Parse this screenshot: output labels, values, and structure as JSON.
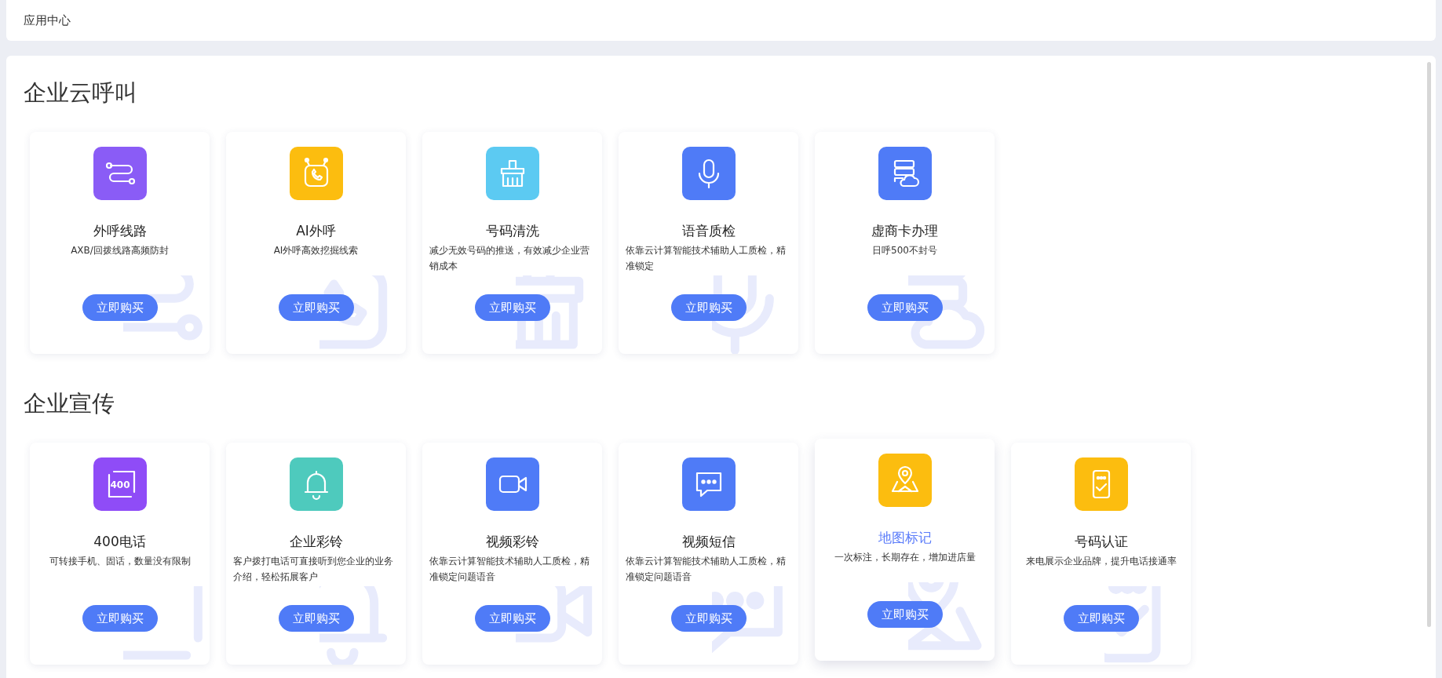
{
  "header": {
    "title": "应用中心"
  },
  "sections": [
    {
      "title": "企业云呼叫",
      "cards": [
        {
          "kind": "route",
          "color": "#8a5cf6",
          "title": "外呼线路",
          "description": "AXB/回拨线路高频防封",
          "button": "立即购买",
          "hovered": false
        },
        {
          "kind": "robot",
          "color": "#fcbd0f",
          "title": "AI外呼",
          "description": "AI外呼高效挖掘线索",
          "button": "立即购买",
          "hovered": false
        },
        {
          "kind": "brush",
          "color": "#5ccaf2",
          "title": "号码清洗",
          "description": "减少无效号码的推送，有效减少企业营销成本",
          "button": "立即购买",
          "hovered": false
        },
        {
          "kind": "mic",
          "color": "#4f7bf7",
          "title": "语音质检",
          "description": "依靠云计算智能技术辅助人工质检，精准锁定",
          "button": "立即购买",
          "hovered": false
        },
        {
          "kind": "server",
          "color": "#4f7bf7",
          "title": "虚商卡办理",
          "description": "日呼500不封号",
          "button": "立即购买",
          "hovered": false
        }
      ]
    },
    {
      "title": "企业宣传",
      "cards": [
        {
          "kind": "number",
          "icon_label": "400",
          "color": "#8f4cf7",
          "title": "400电话",
          "description": "可转接手机、固话，数量没有限制",
          "button": "立即购买",
          "hovered": false
        },
        {
          "kind": "bell",
          "color": "#4ecabd",
          "title": "企业彩铃",
          "description": "客户拨打电话可直接听到您企业的业务介绍，轻松拓展客户",
          "button": "立即购买",
          "hovered": false
        },
        {
          "kind": "video",
          "color": "#4f7bf7",
          "title": "视频彩铃",
          "description": "依靠云计算智能技术辅助人工质检，精准锁定问题语音",
          "button": "立即购买",
          "hovered": false
        },
        {
          "kind": "chat",
          "color": "#4f7bf7",
          "title": "视频短信",
          "description": "依靠云计算智能技术辅助人工质检，精准锁定问题语音",
          "button": "立即购买",
          "hovered": false
        },
        {
          "kind": "map",
          "color": "#fcbd0f",
          "title": "地图标记",
          "description": "一次标注，长期存在，增加进店量",
          "button": "立即购买",
          "hovered": true
        },
        {
          "kind": "phone",
          "color": "#fcbd0f",
          "title": "号码认证",
          "description": "来电展示企业品牌，提升电话接通率",
          "button": "立即购买",
          "hovered": false
        }
      ]
    }
  ]
}
